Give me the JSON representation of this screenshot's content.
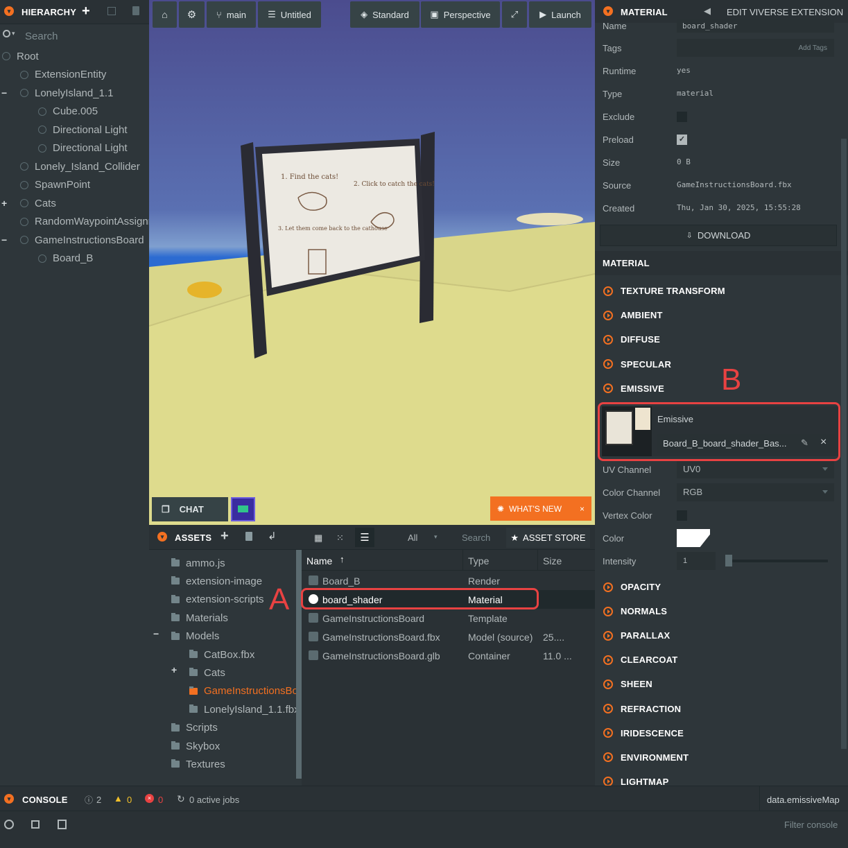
{
  "hierarchy": {
    "title": "HIERARCHY",
    "search_placeholder": "Search",
    "items": [
      {
        "label": "Root",
        "indent": 0,
        "expander": ""
      },
      {
        "label": "ExtensionEntity",
        "indent": 1,
        "expander": ""
      },
      {
        "label": "LonelyIsland_1.1",
        "indent": 1,
        "expander": "−"
      },
      {
        "label": "Cube.005",
        "indent": 2,
        "expander": ""
      },
      {
        "label": "Directional Light",
        "indent": 2,
        "expander": ""
      },
      {
        "label": "Directional Light",
        "indent": 2,
        "expander": ""
      },
      {
        "label": "Lonely_Island_Collider",
        "indent": 1,
        "expander": ""
      },
      {
        "label": "SpawnPoint",
        "indent": 1,
        "expander": ""
      },
      {
        "label": "Cats",
        "indent": 1,
        "expander": "+"
      },
      {
        "label": "RandomWaypointAssignr",
        "indent": 1,
        "expander": ""
      },
      {
        "label": "GameInstructionsBoard",
        "indent": 1,
        "expander": "−"
      },
      {
        "label": "Board_B",
        "indent": 2,
        "expander": ""
      }
    ]
  },
  "toolbar": {
    "branch": "main",
    "scene": "Untitled",
    "render_mode": "Standard",
    "camera": "Perspective",
    "launch": "Launch"
  },
  "viewport": {
    "chat_label": "CHAT",
    "whats_new": "WHAT'S NEW",
    "sign_text": {
      "step1": "1. Find the cats!",
      "step2": "2. Click to catch the cats!",
      "step3": "3. Let them come back to the cathouse"
    }
  },
  "assets": {
    "title": "ASSETS",
    "filter": "All",
    "search_placeholder": "Search",
    "store": "ASSET STORE",
    "folders": [
      {
        "label": "ammo.js",
        "indent": 0,
        "expander": "",
        "active": false
      },
      {
        "label": "extension-image",
        "indent": 0,
        "expander": "",
        "active": false
      },
      {
        "label": "extension-scripts",
        "indent": 0,
        "expander": "",
        "active": false
      },
      {
        "label": "Materials",
        "indent": 0,
        "expander": "",
        "active": false
      },
      {
        "label": "Models",
        "indent": 0,
        "expander": "−",
        "active": false
      },
      {
        "label": "CatBox.fbx",
        "indent": 1,
        "expander": "",
        "active": false
      },
      {
        "label": "Cats",
        "indent": 1,
        "expander": "+",
        "active": false
      },
      {
        "label": "GameInstructionsBo",
        "indent": 1,
        "expander": "",
        "active": true
      },
      {
        "label": "LonelyIsland_1.1.fbx",
        "indent": 1,
        "expander": "",
        "active": false
      },
      {
        "label": "Scripts",
        "indent": 0,
        "expander": "",
        "active": false
      },
      {
        "label": "Skybox",
        "indent": 0,
        "expander": "",
        "active": false
      },
      {
        "label": "Textures",
        "indent": 0,
        "expander": "",
        "active": false
      }
    ],
    "columns": [
      "Name",
      "Type",
      "Size"
    ],
    "rows": [
      {
        "name": "Board_B",
        "type": "Render",
        "size": "",
        "selected": false
      },
      {
        "name": "board_shader",
        "type": "Material",
        "size": "",
        "selected": true
      },
      {
        "name": "GameInstructionsBoard",
        "type": "Template",
        "size": "",
        "selected": false
      },
      {
        "name": "GameInstructionsBoard.fbx",
        "type": "Model (source)",
        "size": "25....",
        "selected": false
      },
      {
        "name": "GameInstructionsBoard.glb",
        "type": "Container",
        "size": "11.0 ...",
        "selected": false
      }
    ]
  },
  "inspector": {
    "title": "MATERIAL",
    "edit_ext": "EDIT VIVERSE EXTENSION",
    "props": {
      "name_label": "Name",
      "name_value": "board_shader",
      "tags_label": "Tags",
      "tags_placeholder": "Add Tags",
      "runtime_label": "Runtime",
      "runtime_value": "yes",
      "type_label": "Type",
      "type_value": "material",
      "exclude_label": "Exclude",
      "preload_label": "Preload",
      "size_label": "Size",
      "size_value": "0 B",
      "source_label": "Source",
      "source_value": "GameInstructionsBoard.fbx",
      "created_label": "Created",
      "created_value": "Thu, Jan 30, 2025, 15:55:28"
    },
    "download": "DOWNLOAD",
    "material_header": "MATERIAL",
    "sections_top": [
      "TEXTURE TRANSFORM",
      "AMBIENT",
      "DIFFUSE",
      "SPECULAR",
      "EMISSIVE"
    ],
    "emissive": {
      "label": "Emissive",
      "texture": "Board_B_board_shader_Bas..."
    },
    "uv_label": "UV Channel",
    "uv_value": "UV0",
    "color_channel_label": "Color Channel",
    "color_channel_value": "RGB",
    "vertex_label": "Vertex Color",
    "color_label": "Color",
    "intensity_label": "Intensity",
    "intensity_value": "1",
    "sections_bottom": [
      "OPACITY",
      "NORMALS",
      "PARALLAX",
      "CLEARCOAT",
      "SHEEN",
      "REFRACTION",
      "IRIDESCENCE",
      "ENVIRONMENT",
      "LIGHTMAP"
    ]
  },
  "console": {
    "title": "CONSOLE",
    "info_count": "2",
    "warn_count": "0",
    "error_count": "0",
    "jobs": "0 active jobs",
    "path": "data.emissiveMap",
    "filter_placeholder": "Filter console"
  },
  "annotations": {
    "a": "A",
    "b": "B"
  },
  "colors": {
    "accent": "#f37021",
    "annotation": "#e84242"
  }
}
